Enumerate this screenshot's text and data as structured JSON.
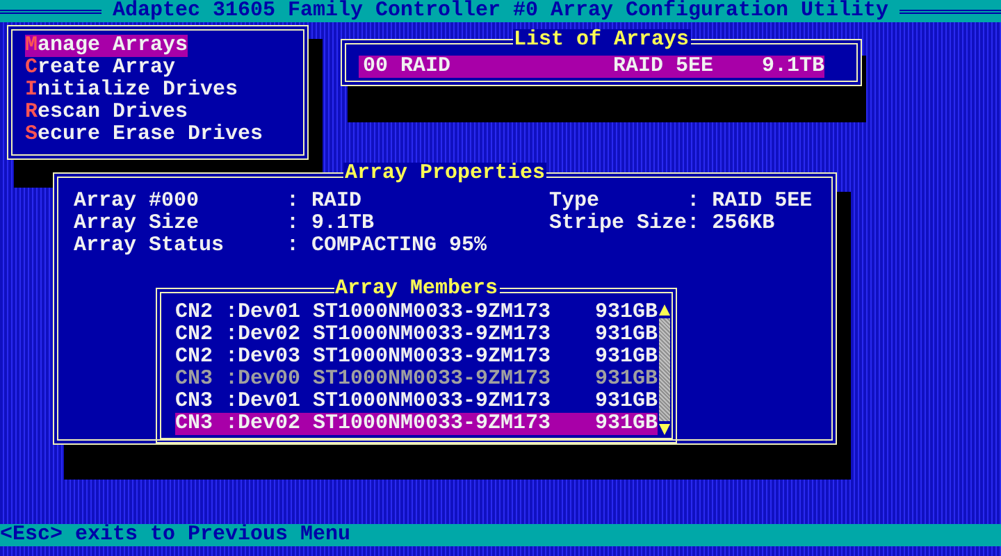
{
  "title_bar": {
    "title": "Adaptec 31605 Family Controller #0 Array Configuration Utility"
  },
  "menu": {
    "items": [
      {
        "label": "Manage Arrays",
        "selected": true
      },
      {
        "label": "Create Array",
        "selected": false
      },
      {
        "label": "Initialize Drives",
        "selected": false
      },
      {
        "label": "Rescan Drives",
        "selected": false
      },
      {
        "label": "Secure Erase Drives",
        "selected": false
      }
    ]
  },
  "arrays_list": {
    "title": "List of Arrays",
    "rows": [
      {
        "name": "00 RAID",
        "type": "RAID 5EE",
        "size": "9.1TB",
        "selected": true
      }
    ]
  },
  "properties": {
    "title": "Array Properties",
    "left": [
      {
        "label": "Array #000",
        "value": ": RAID"
      },
      {
        "label": "Array Size",
        "value": ": 9.1TB"
      },
      {
        "label": "Array Status",
        "value": ": COMPACTING 95%"
      }
    ],
    "right": [
      {
        "label": "Type",
        "value": ": RAID 5EE"
      },
      {
        "label": "Stripe Size",
        "value": ": 256KB"
      }
    ]
  },
  "members": {
    "title": "Array Members",
    "rows": [
      {
        "channel": "CN2",
        "device": ":Dev01",
        "model": "ST1000NM0033-9ZM173",
        "size": "931GB",
        "selected": false,
        "disabled": false
      },
      {
        "channel": "CN2",
        "device": ":Dev02",
        "model": "ST1000NM0033-9ZM173",
        "size": "931GB",
        "selected": false,
        "disabled": false
      },
      {
        "channel": "CN2",
        "device": ":Dev03",
        "model": "ST1000NM0033-9ZM173",
        "size": "931GB",
        "selected": false,
        "disabled": false
      },
      {
        "channel": "CN3",
        "device": ":Dev00",
        "model": "ST1000NM0033-9ZM173",
        "size": "931GB",
        "selected": false,
        "disabled": true
      },
      {
        "channel": "CN3",
        "device": ":Dev01",
        "model": "ST1000NM0033-9ZM173",
        "size": "931GB",
        "selected": false,
        "disabled": false
      },
      {
        "channel": "CN3",
        "device": ":Dev02",
        "model": "ST1000NM0033-9ZM173",
        "size": "931GB",
        "selected": true,
        "disabled": false
      }
    ]
  },
  "status_bar": {
    "text": "<Esc> exits to Previous Menu"
  }
}
